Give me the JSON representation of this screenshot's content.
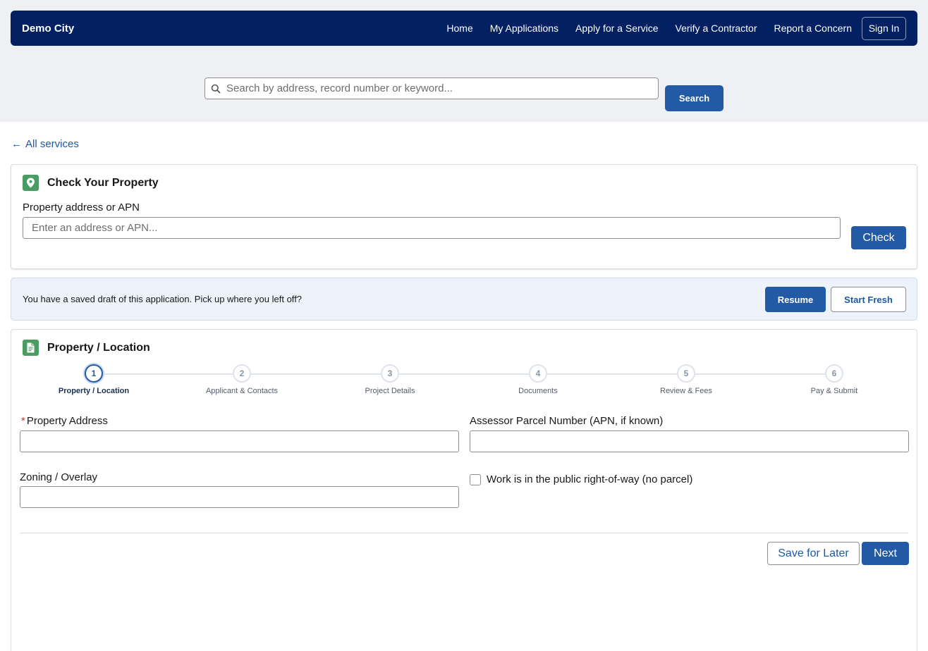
{
  "nav": {
    "brand": "Demo City",
    "links": [
      "Home",
      "My Applications",
      "Apply for a Service",
      "Verify a Contractor",
      "Report a Concern"
    ],
    "signin": "Sign In"
  },
  "search": {
    "placeholder": "Search by address, record number or keyword...",
    "button": "Search"
  },
  "back_link": "All services",
  "check_property": {
    "title": "Check Your Property",
    "field_label": "Property address or APN",
    "placeholder": "Enter an address or APN...",
    "button": "Check"
  },
  "draft": {
    "message": "You have a saved draft of this application. Pick up where you left off?",
    "resume": "Resume",
    "start_fresh": "Start Fresh"
  },
  "form": {
    "title": "Property / Location",
    "steps": [
      {
        "number": "1",
        "label": "Property / Location"
      },
      {
        "number": "2",
        "label": "Applicant & Contacts"
      },
      {
        "number": "3",
        "label": "Project Details"
      },
      {
        "number": "4",
        "label": "Documents"
      },
      {
        "number": "5",
        "label": "Review & Fees"
      },
      {
        "number": "6",
        "label": "Pay & Submit"
      }
    ],
    "active_step": 1,
    "required_marker": "*",
    "property_address_label": "Property Address",
    "apn_label": "Assessor Parcel Number (APN, if known)",
    "zoning_label": "Zoning / Overlay",
    "row_checkbox_label": "Work is in the public right-of-way (no parcel)",
    "save_later": "Save for Later",
    "next": "Next"
  },
  "colors": {
    "navbar": "#032063",
    "primary": "#235aa6",
    "icon_green": "#4b9c62",
    "required": "#c23934"
  }
}
